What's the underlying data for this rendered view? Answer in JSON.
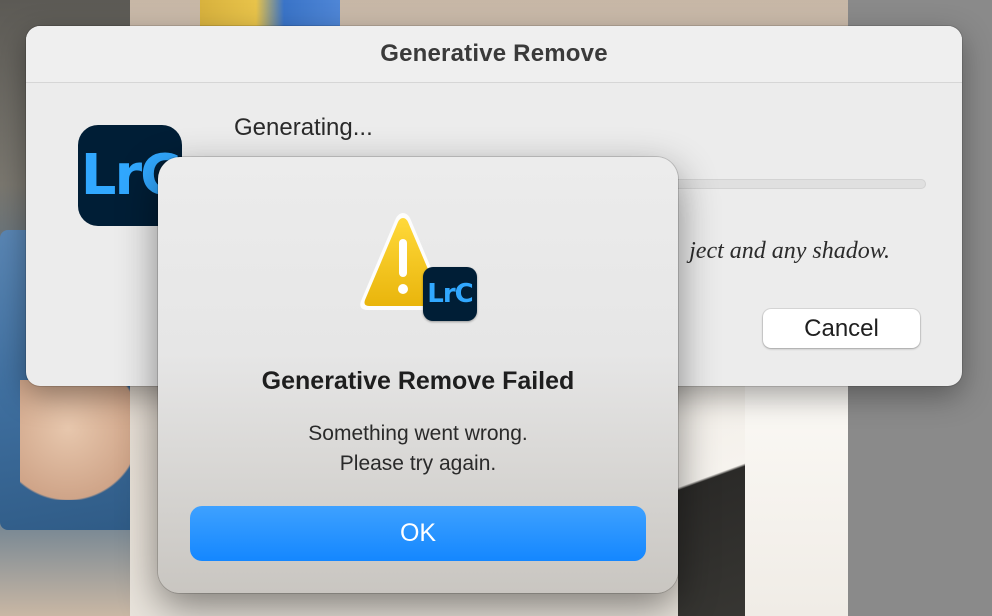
{
  "back_dialog": {
    "title": "Generative Remove",
    "app_icon_text": "LrC",
    "status": "Generating...",
    "hint_visible": "ject and any shadow.",
    "cancel_label": "Cancel"
  },
  "alert": {
    "badge_text": "LrC",
    "title": "Generative Remove Failed",
    "message_line1": "Something went wrong.",
    "message_line2": "Please try again.",
    "ok_label": "OK"
  },
  "colors": {
    "accent": "#1487ff",
    "lightroom_bg": "#001e36",
    "lightroom_text": "#31a8ff",
    "warning_yellow": "#f2c21b"
  },
  "icons": {
    "warning": "warning-triangle-icon",
    "app": "lightroom-classic-icon"
  }
}
